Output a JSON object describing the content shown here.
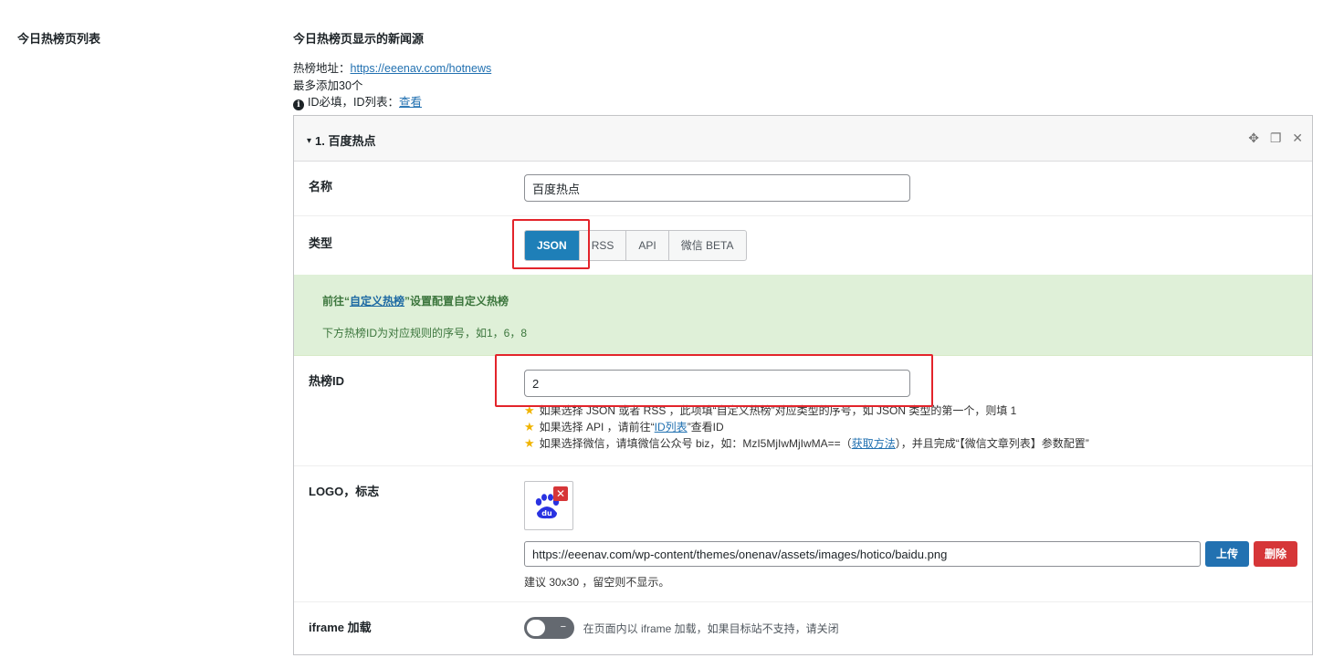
{
  "section": {
    "label": "今日热榜页列表"
  },
  "field": {
    "title": "今日热榜页显示的新闻源",
    "address_prefix": "热榜地址：",
    "address_link": "https://eeenav.com/hotnews",
    "max_note": "最多添加30个",
    "id_note_prefix": "ID必填，ID列表：",
    "id_note_link": "查看"
  },
  "group": {
    "title": "1. 百度热点",
    "icons": [
      "move-icon",
      "copy-icon",
      "close-icon"
    ]
  },
  "name_row": {
    "label": "名称",
    "value": "百度热点"
  },
  "type_row": {
    "label": "类型",
    "options": [
      "JSON",
      "RSS",
      "API",
      "微信 BETA"
    ],
    "selected": "JSON"
  },
  "notice": {
    "line1_prefix": "前往“",
    "line1_link": "自定义热榜",
    "line1_suffix": "”设置配置自定义热榜",
    "line2": "下方热榜ID为对应规则的序号，如1，6，8"
  },
  "hotid_row": {
    "label": "热榜ID",
    "value": "2",
    "hint1": "如果选择 JSON 或者 RSS ，此项填“自定义热榜”对应类型的序号，如 JSON 类型的第一个，则填 1",
    "hint2_prefix": "如果选择 API ，请前往“",
    "hint2_link": "ID列表",
    "hint2_suffix": "”查看ID",
    "hint3_prefix": "如果选择微信，请填微信公众号 biz，如：MzI5MjIwMjIwMA==（",
    "hint3_link": "获取方法",
    "hint3_suffix": "），并且完成“【微信文章列表】参数配置”"
  },
  "logo_row": {
    "label": "LOGO，标志",
    "url": "https://eeenav.com/wp-content/themes/onenav/assets/images/hotico/baidu.png",
    "upload_label": "上传",
    "delete_label": "删除",
    "note": "建议 30x30 ，留空则不显示。"
  },
  "iframe_row": {
    "label": "iframe 加载",
    "toggle_dash": "−",
    "desc": "在页面内以 iframe 加载，如果目标站不支持，请关闭"
  },
  "colors": {
    "primary": "#2271b1",
    "danger": "#d63638",
    "active": "#1e7fb8",
    "notice_bg": "#dff0d8",
    "highlight": "#e3242b"
  }
}
